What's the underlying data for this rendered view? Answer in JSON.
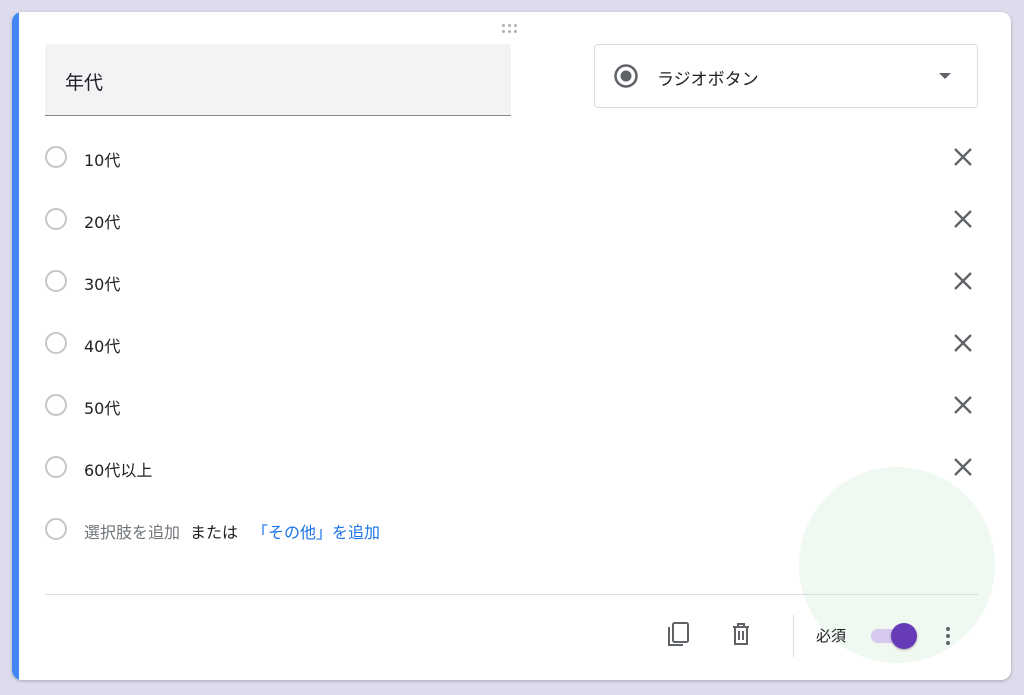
{
  "question": {
    "title": "年代",
    "type_label": "ラジオボタン",
    "options": [
      {
        "label": "10代"
      },
      {
        "label": "20代"
      },
      {
        "label": "30代"
      },
      {
        "label": "40代"
      },
      {
        "label": "50代"
      },
      {
        "label": "60代以上"
      }
    ],
    "add_option_label": "選択肢を追加",
    "or_label": "または",
    "add_other_label": "「その他」を追加"
  },
  "footer": {
    "required_label": "必須",
    "required_on": true
  },
  "icons": {
    "drag": "drag-handle-icon",
    "type": "radio-button-checked-icon",
    "dropdown": "arrow-drop-down-icon",
    "remove": "close-icon",
    "duplicate": "content-copy-icon",
    "delete": "delete-icon",
    "more": "more-vert-icon"
  },
  "colors": {
    "accent_bar": "#4285f4",
    "toggle_thumb": "#673ab7",
    "toggle_track": "#d7c8ee",
    "link": "#1a73e8"
  }
}
